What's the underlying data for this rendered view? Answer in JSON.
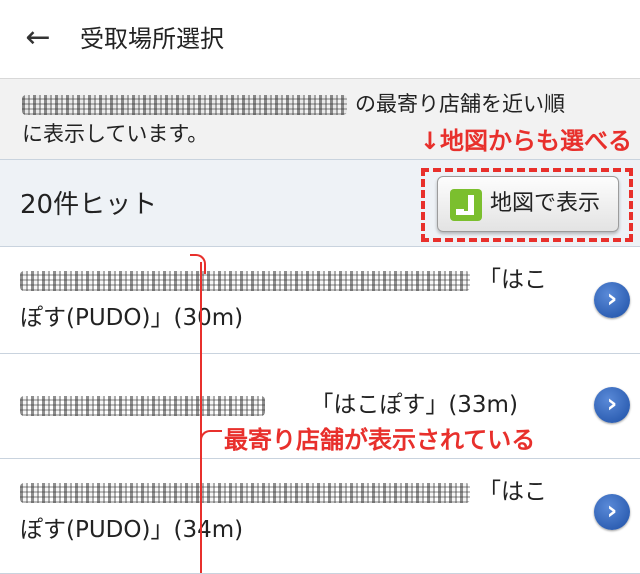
{
  "header": {
    "title": "受取場所選択",
    "back_icon": "back-arrow-icon"
  },
  "notice": {
    "line1_suffix": "の最寄り店舗を近い順",
    "line2": "に表示しています。"
  },
  "annotation_map": "↓地図からも選べる",
  "count": {
    "label": "20件ヒット"
  },
  "map_button": {
    "label": "地図で表示",
    "icon": "map-icon"
  },
  "items": [
    {
      "line1_suffix": "「はこ",
      "line2": "ぽす(PUDO)」(30m)"
    },
    {
      "line1_suffix": "「はこぽす」(33m)"
    },
    {
      "line1_suffix": "「はこ",
      "line2": "ぽす(PUDO)」(34m)"
    }
  ],
  "annotation_list": "最寄り店舗が表示されている",
  "colors": {
    "annotation": "#e8302c",
    "chevron": "#1d4fa5"
  }
}
